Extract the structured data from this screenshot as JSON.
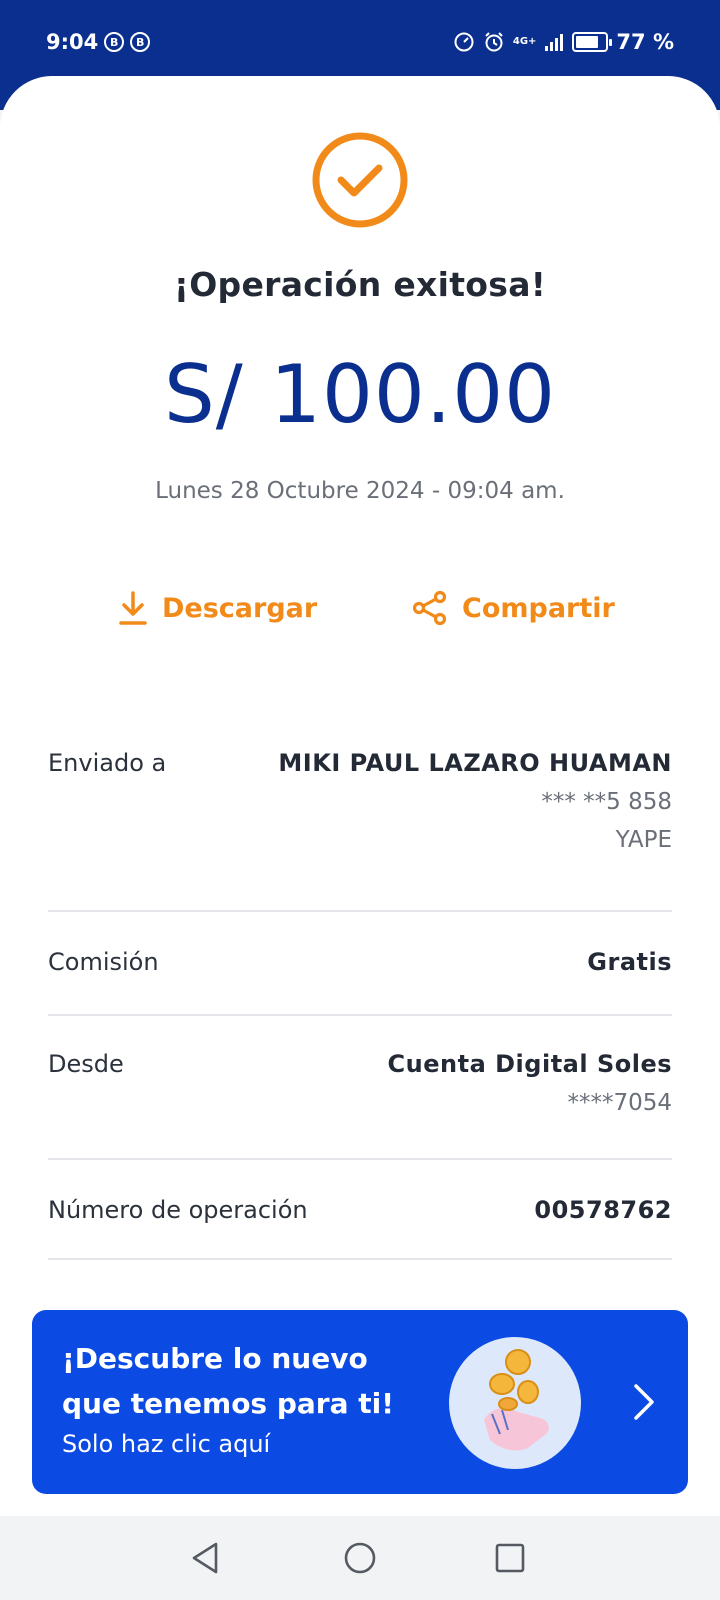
{
  "status_bar": {
    "time": "9:04",
    "badges": [
      "B",
      "B"
    ],
    "network": "4G+",
    "battery_percent_text": "77 %",
    "battery_level": 0.77,
    "icons": [
      "speed-icon",
      "alarm-icon",
      "signal-icon",
      "battery-icon"
    ]
  },
  "receipt": {
    "title": "¡Operación exitosa!",
    "amount": "S/ 100.00",
    "datetime": "Lunes 28 Octubre 2024 - 09:04 am.",
    "status_icon": "check-circle-icon"
  },
  "actions": {
    "download_label": "Descargar",
    "share_label": "Compartir"
  },
  "details": {
    "sent_to": {
      "label": "Enviado a",
      "name": "MIKI PAUL LAZARO HUAMAN",
      "phone": "*** **5 858",
      "channel": "YAPE"
    },
    "commission": {
      "label": "Comisión",
      "value": "Gratis"
    },
    "from": {
      "label": "Desde",
      "account": "Cuenta Digital Soles",
      "number": "****7054"
    },
    "operation_number": {
      "label": "Número de operación",
      "value": "00578762"
    }
  },
  "banner": {
    "title": "¡Descubre lo nuevo que tenemos para ti!",
    "subtitle": "Solo haz clic aquí",
    "art": "hand-coins-icon"
  },
  "colors": {
    "brand_blue": "#0a2f8e",
    "banner_blue": "#0b4be3",
    "accent_orange": "#f28a1a"
  }
}
